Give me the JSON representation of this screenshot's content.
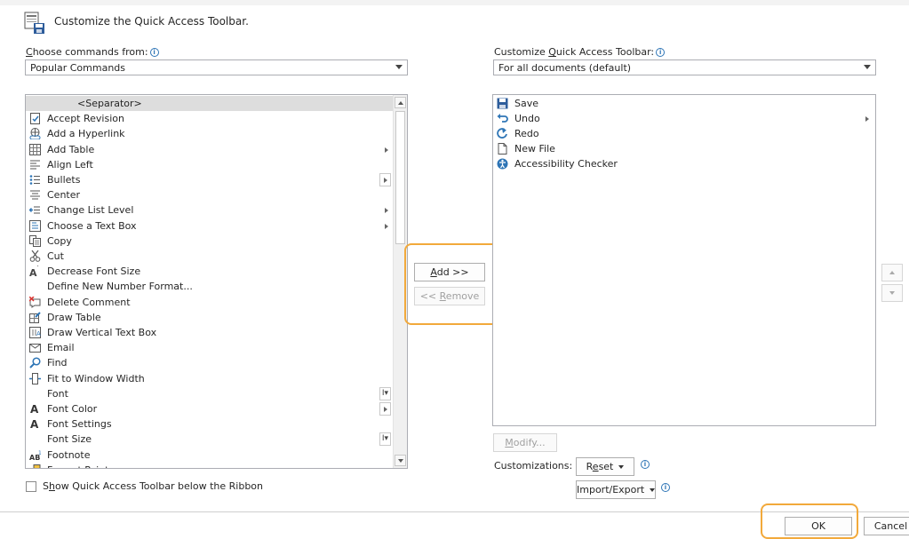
{
  "header": {
    "title": "Customize the Quick Access Toolbar."
  },
  "left": {
    "choose_label_pre": "",
    "choose_label_ul": "C",
    "choose_label_post": "hoose commands from:",
    "choose_value": "Popular Commands",
    "commands": [
      {
        "label": "<Separator>",
        "icon": "separator",
        "selected": true
      },
      {
        "label": "Accept Revision",
        "icon": "accept-revision-icon"
      },
      {
        "label": "Add a Hyperlink",
        "icon": "hyperlink-icon"
      },
      {
        "label": "Add Table",
        "icon": "table-icon",
        "submenu": true
      },
      {
        "label": "Align Left",
        "icon": "align-left-icon"
      },
      {
        "label": "Bullets",
        "icon": "bullets-icon",
        "split": true
      },
      {
        "label": "Center",
        "icon": "center-align-icon"
      },
      {
        "label": "Change List Level",
        "icon": "list-level-icon",
        "submenu": true
      },
      {
        "label": "Choose a Text Box",
        "icon": "text-box-icon",
        "submenu": true
      },
      {
        "label": "Copy",
        "icon": "copy-icon"
      },
      {
        "label": "Cut",
        "icon": "cut-icon"
      },
      {
        "label": "Decrease Font Size",
        "icon": "decrease-font-icon"
      },
      {
        "label": "Define New Number Format...",
        "icon": ""
      },
      {
        "label": "Delete Comment",
        "icon": "delete-comment-icon"
      },
      {
        "label": "Draw Table",
        "icon": "draw-table-icon"
      },
      {
        "label": "Draw Vertical Text Box",
        "icon": "vertical-text-box-icon"
      },
      {
        "label": "Email",
        "icon": "email-icon"
      },
      {
        "label": "Find",
        "icon": "find-icon"
      },
      {
        "label": "Fit to Window Width",
        "icon": "fit-width-icon"
      },
      {
        "label": "Font",
        "icon": "",
        "combo": true
      },
      {
        "label": "Font Color",
        "icon": "font-color-icon",
        "split": true
      },
      {
        "label": "Font Settings",
        "icon": "font-settings-icon"
      },
      {
        "label": "Font Size",
        "icon": "",
        "combo": true
      },
      {
        "label": "Footnote",
        "icon": "footnote-icon"
      },
      {
        "label": "Format Painter",
        "icon": "format-painter-icon"
      }
    ],
    "show_below_ribbon_pre": "S",
    "show_below_ribbon_ul": "h",
    "show_below_ribbon_post": "ow Quick Access Toolbar below the Ribbon"
  },
  "middle": {
    "add_ul": "A",
    "add_rest": "dd >>",
    "remove_pre": "<< ",
    "remove_ul": "R",
    "remove_rest": "emove"
  },
  "right": {
    "customize_label_pre": "Customize ",
    "customize_label_ul": "Q",
    "customize_label_post": "uick Access Toolbar:",
    "customize_value": "For all documents (default)",
    "toolbar_items": [
      {
        "label": "Save",
        "icon": "save-icon"
      },
      {
        "label": "Undo",
        "icon": "undo-icon",
        "split": true
      },
      {
        "label": "Redo",
        "icon": "redo-icon"
      },
      {
        "label": "New File",
        "icon": "new-file-icon"
      },
      {
        "label": "Accessibility Checker",
        "icon": "accessibility-icon"
      }
    ],
    "modify_ul": "M",
    "modify_rest": "odify...",
    "customizations_label": "Customizations:",
    "reset_pre": "R",
    "reset_ul": "e",
    "reset_post": "set",
    "import_export": "Import/Export"
  },
  "footer": {
    "ok": "OK",
    "cancel": "Cancel"
  },
  "colors": {
    "highlight": "#f2a93b",
    "icon_blue": "#2e75b6",
    "selected_row": "#dddddd"
  }
}
